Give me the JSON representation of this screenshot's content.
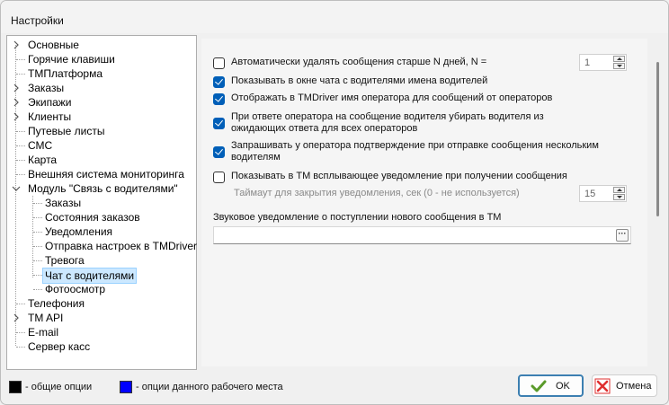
{
  "window": {
    "title": "Настройки"
  },
  "tree": {
    "items": [
      {
        "label": "Основные",
        "expandable": true
      },
      {
        "label": "Горячие клавиши",
        "expandable": false
      },
      {
        "label": "ТМПлатформа",
        "expandable": false
      },
      {
        "label": "Заказы",
        "expandable": true
      },
      {
        "label": "Экипажи",
        "expandable": true
      },
      {
        "label": "Клиенты",
        "expandable": true
      },
      {
        "label": "Путевые листы",
        "expandable": false
      },
      {
        "label": "СМС",
        "expandable": false
      },
      {
        "label": "Карта",
        "expandable": false
      },
      {
        "label": "Внешняя система мониторинга",
        "expandable": false
      },
      {
        "label": "Модуль \"Связь с водителями\"",
        "expandable": true,
        "expanded": true
      },
      {
        "label": "Заказы",
        "child": true
      },
      {
        "label": "Состояния заказов",
        "child": true
      },
      {
        "label": "Уведомления",
        "child": true
      },
      {
        "label": "Отправка настроек в TMDriver",
        "child": true
      },
      {
        "label": "Тревога",
        "child": true
      },
      {
        "label": "Чат с водителями",
        "child": true,
        "selected": true
      },
      {
        "label": "Фотоосмотр",
        "child": true
      },
      {
        "label": "Телефония",
        "expandable": false
      },
      {
        "label": "TM API",
        "expandable": true
      },
      {
        "label": "E-mail",
        "expandable": false
      },
      {
        "label": "Сервер касс",
        "expandable": false
      }
    ]
  },
  "options": {
    "auto_delete": {
      "label": "Автоматически удалять сообщения старше N дней, N =",
      "checked": false,
      "value": "1"
    },
    "show_names": {
      "label": "Показывать в окне чата с водителями имена водителей",
      "checked": true
    },
    "show_operator_name": {
      "label": "Отображать в TMDriver имя оператора для сообщений от операторов",
      "checked": true
    },
    "remove_driver": {
      "label": "При ответе оператора на сообщение водителя убирать водителя из ожидающих ответа для всех операторов",
      "checked": true
    },
    "confirm_multi": {
      "label": "Запрашивать у оператора подтверждение при отправке сообщения нескольким водителям",
      "checked": true
    },
    "popup_notify": {
      "label": "Показывать в ТМ всплывающее уведомление при получении сообщения",
      "checked": false
    },
    "timeout": {
      "label": "Таймаут для закрытия уведомления, сек (0 - не используется)",
      "value": "15"
    },
    "sound": {
      "label": "Звуковое уведомление о поступлении нового сообщения в ТМ",
      "value": "",
      "button": "···"
    }
  },
  "footer": {
    "legend_common": "- общие опции",
    "legend_workplace": "- опции данного рабочего места",
    "ok_label": "OK",
    "cancel_label": "Отмена"
  },
  "colors": {
    "legend_common": "#000000",
    "legend_workplace": "#0000ff",
    "checkbox_accent": "#005fb8",
    "selection": "#cce8ff",
    "ok_icon": "#5a9a2a",
    "cancel_icon": "#e03030"
  }
}
